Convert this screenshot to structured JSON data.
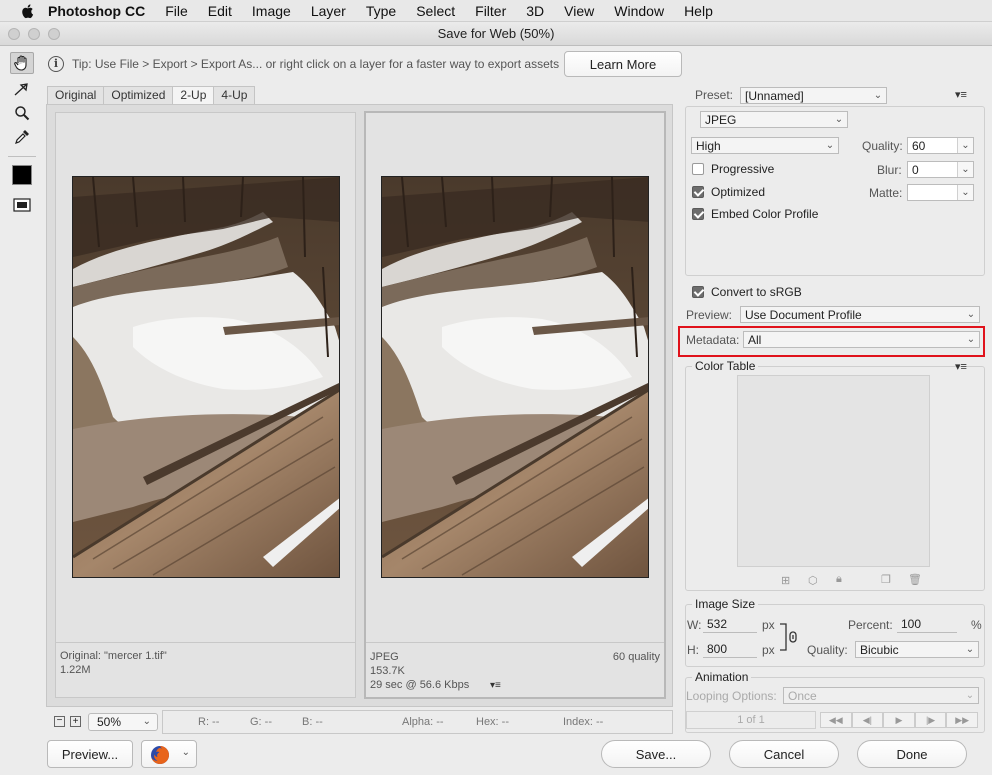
{
  "menubar": {
    "app": "Photoshop CC",
    "items": [
      "File",
      "Edit",
      "Image",
      "Layer",
      "Type",
      "Select",
      "Filter",
      "3D",
      "View",
      "Window",
      "Help"
    ]
  },
  "window": {
    "title": "Save for Web (50%)"
  },
  "tip": {
    "text": "Tip: Use File > Export > Export As...  or right click on a layer for a faster way to export assets",
    "learn_more": "Learn More"
  },
  "tabs": [
    "Original",
    "Optimized",
    "2-Up",
    "4-Up"
  ],
  "selected_tab": "2-Up",
  "panes": {
    "original": {
      "name": "Original: \"mercer 1.tif\"",
      "size": "1.22M"
    },
    "optimized": {
      "format": "JPEG",
      "quality": "60 quality",
      "size": "153.7K",
      "time": "29 sec @ 56.6 Kbps"
    }
  },
  "status": {
    "zoom": "50%",
    "r": "R: --",
    "g": "G: --",
    "b": "B: --",
    "alpha": "Alpha: --",
    "hex": "Hex: --",
    "index": "Index: --"
  },
  "bottom_buttons": {
    "preview": "Preview...",
    "save": "Save...",
    "cancel": "Cancel",
    "done": "Done"
  },
  "settings": {
    "preset_label": "Preset:",
    "preset_value": "[Unnamed]",
    "format": "JPEG",
    "compression": "High",
    "quality_label": "Quality:",
    "quality_value": "60",
    "blur_label": "Blur:",
    "blur_value": "0",
    "matte_label": "Matte:",
    "progressive": "Progressive",
    "optimized": "Optimized",
    "embed_profile": "Embed Color Profile",
    "convert_srgb": "Convert to sRGB",
    "preview_label": "Preview:",
    "preview_value": "Use Document Profile",
    "metadata_label": "Metadata:",
    "metadata_value": "All",
    "color_table": "Color Table"
  },
  "image_size": {
    "title": "Image Size",
    "w_label": "W:",
    "w_value": "532",
    "h_label": "H:",
    "h_value": "800",
    "unit": "px",
    "percent_label": "Percent:",
    "percent_value": "100",
    "percent_unit": "%",
    "quality_label": "Quality:",
    "quality_value": "Bicubic"
  },
  "animation": {
    "title": "Animation",
    "looping_label": "Looping Options:",
    "looping_value": "Once",
    "frame": "1 of 1"
  },
  "colors": {
    "highlight": "#e0121b"
  }
}
